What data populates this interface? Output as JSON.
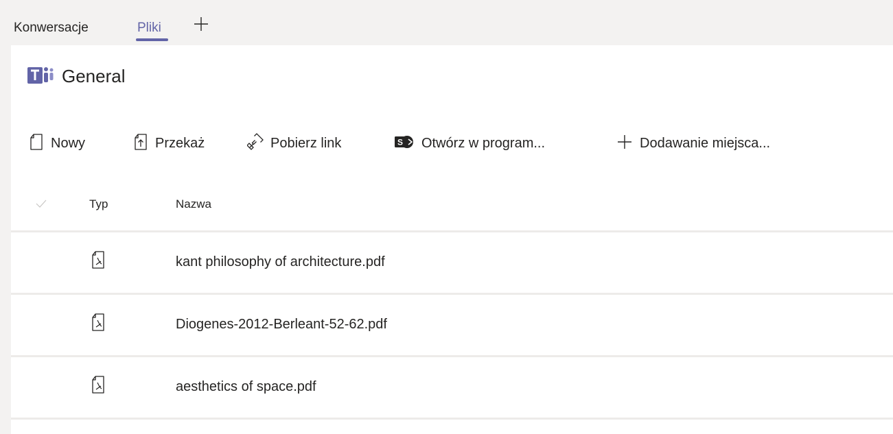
{
  "tabs": [
    {
      "label": "Konwersacje",
      "active": false
    },
    {
      "label": "Pliki",
      "active": true
    }
  ],
  "add_tab_icon": "plus-icon",
  "channel": {
    "title": "General",
    "icon": "teams-logo-icon"
  },
  "toolbar": {
    "new_label": "Nowy",
    "upload_label": "Przekaż",
    "get_link_label": "Pobierz link",
    "open_in_label": "Otwórz w program...",
    "add_storage_label": "Dodawanie miejsca..."
  },
  "table": {
    "columns": {
      "type": "Typ",
      "name": "Nazwa"
    },
    "rows": [
      {
        "icon": "pdf-file-icon",
        "name": "kant philosophy of architecture.pdf"
      },
      {
        "icon": "pdf-file-icon",
        "name": "Diogenes-2012-Berleant-52-62.pdf"
      },
      {
        "icon": "pdf-file-icon",
        "name": "aesthetics of space.pdf"
      }
    ]
  },
  "colors": {
    "accent": "#6264a7",
    "background": "#f3f2f1",
    "panel": "#ffffff",
    "divider": "#edebe9",
    "text": "#252423"
  }
}
